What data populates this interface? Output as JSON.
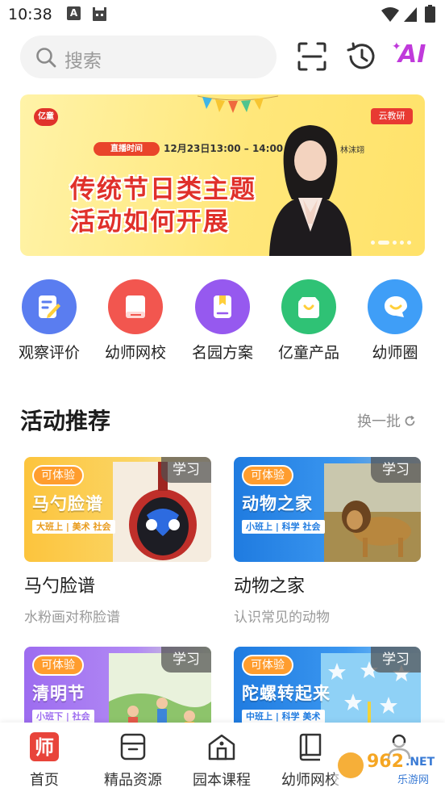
{
  "status_bar": {
    "time": "10:38"
  },
  "search": {
    "placeholder": "搜索"
  },
  "top_actions": {
    "ai_label": "AI"
  },
  "banner": {
    "live_tag": "直播时间",
    "time": "12月23日13:00 – 14:00",
    "title_line1": "传统节日类主题",
    "title_line2": "活动如何开展",
    "host": "林沫翊",
    "badge": "云教研"
  },
  "quick_menu": [
    {
      "label": "观察评价",
      "color": "#5a7df0"
    },
    {
      "label": "幼师网校",
      "color": "#f2564f"
    },
    {
      "label": "名园方案",
      "color": "#9659ef"
    },
    {
      "label": "亿童产品",
      "color": "#2fc275"
    },
    {
      "label": "幼师圈",
      "color": "#3f9ef7"
    }
  ],
  "recommend": {
    "title": "活动推荐",
    "refresh_label": "换一批",
    "cards": [
      {
        "tag": "可体验",
        "study": "学习",
        "thumb_title": "马勺脸谱",
        "thumb_tags": "大班上 | 美术 社会",
        "title": "马勺脸谱",
        "subtitle": "水粉画对称脸谱"
      },
      {
        "tag": "可体验",
        "study": "学习",
        "thumb_title": "动物之家",
        "thumb_tags": "小班上 | 科学 社会",
        "title": "动物之家",
        "subtitle": "认识常见的动物"
      },
      {
        "tag": "可体验",
        "study": "学习",
        "thumb_title": "清明节",
        "thumb_tags": "小班下 | 社会"
      },
      {
        "tag": "可体验",
        "study": "学习",
        "thumb_title": "陀螺转起来",
        "thumb_tags": "中班上 | 科学 美术"
      }
    ]
  },
  "bottom_nav": [
    {
      "label": "首页",
      "active": true
    },
    {
      "label": "精品资源"
    },
    {
      "label": "园本课程"
    },
    {
      "label": "幼师网校"
    }
  ],
  "colors": {
    "accent": "#e8443a",
    "ai": "#c03adb"
  }
}
